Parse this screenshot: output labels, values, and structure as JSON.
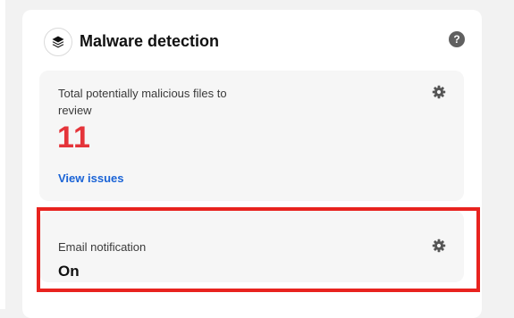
{
  "card": {
    "title": "Malware detection",
    "icon": "layers-icon",
    "help_icon": "help-icon"
  },
  "issues": {
    "label": "Total potentially malicious files to review",
    "count": "11",
    "link": "View issues",
    "settings_icon": "gear-icon"
  },
  "email": {
    "label": "Email notification",
    "value": "On",
    "settings_icon": "gear-icon"
  },
  "colors": {
    "count": "#e5343a",
    "link": "#1a63d6",
    "highlight": "#e8231f"
  }
}
